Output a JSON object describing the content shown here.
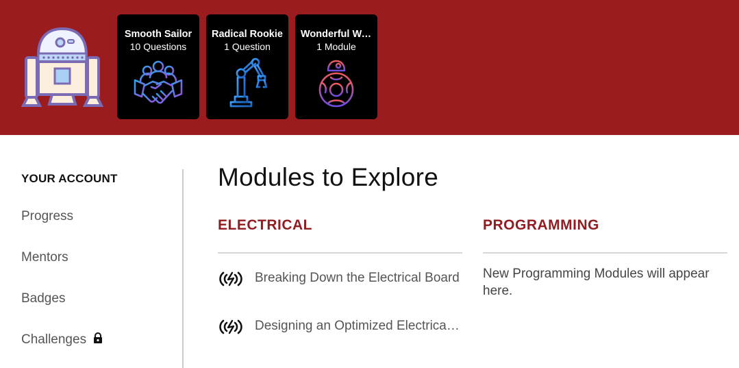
{
  "colors": {
    "header_bg": "#9b1c1f",
    "accent": "#8f1d22",
    "badge_bg": "#000000"
  },
  "avatar": {
    "icon": "robot-icon"
  },
  "badges": [
    {
      "title": "Smooth Sailor",
      "subtitle": "10 Questions",
      "icon": "handshake-icon"
    },
    {
      "title": "Radical Rookie",
      "subtitle": "1 Question",
      "icon": "robot-arm-icon"
    },
    {
      "title": "Wonderful Wanderer",
      "subtitle": "1 Module",
      "icon": "bb8-droid-icon"
    }
  ],
  "sidebar": {
    "heading": "YOUR ACCOUNT",
    "items": [
      {
        "label": "Progress"
      },
      {
        "label": "Mentors"
      },
      {
        "label": "Badges"
      },
      {
        "label": "Challenges",
        "icon": "lock-icon"
      }
    ]
  },
  "main": {
    "title": "Modules to Explore",
    "sections": [
      {
        "title": "ELECTRICAL",
        "modules": [
          {
            "label": "Breaking Down the Electrical Board",
            "icon": "power-wave-icon"
          },
          {
            "label": "Designing an Optimized Electrical System",
            "icon": "power-wave-icon"
          }
        ]
      },
      {
        "title": "PROGRAMMING",
        "empty_message": "New Programming Modules will appear here."
      }
    ]
  }
}
